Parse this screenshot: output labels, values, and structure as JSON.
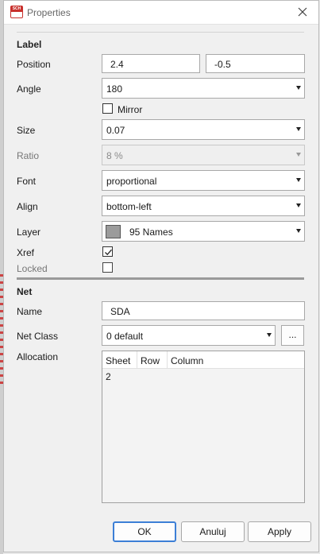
{
  "window": {
    "title": "Properties",
    "app_icon_text": "SCH"
  },
  "label_section": {
    "heading": "Label",
    "position": {
      "label": "Position",
      "x": "2.4",
      "y": "-0.5"
    },
    "angle": {
      "label": "Angle",
      "value": "180"
    },
    "mirror": {
      "label": "Mirror",
      "checked": false
    },
    "size": {
      "label": "Size",
      "value": "0.07"
    },
    "ratio": {
      "label": "Ratio",
      "value": "8 %",
      "disabled": true
    },
    "font": {
      "label": "Font",
      "value": "proportional"
    },
    "align": {
      "label": "Align",
      "value": "bottom-left"
    },
    "layer": {
      "label": "Layer",
      "value": "95 Names",
      "swatch_color": "#9b9b9b"
    },
    "xref": {
      "label": "Xref",
      "checked": true
    },
    "locked": {
      "label": "Locked",
      "checked": false
    }
  },
  "net_section": {
    "heading": "Net",
    "name": {
      "label": "Name",
      "value": "SDA"
    },
    "net_class": {
      "label": "Net Class",
      "value": "0 default",
      "more_button": "..."
    },
    "allocation": {
      "label": "Allocation",
      "columns": [
        "Sheet",
        "Row",
        "Column"
      ],
      "rows": [
        [
          "2",
          "",
          ""
        ]
      ]
    }
  },
  "buttons": {
    "ok": "OK",
    "cancel": "Anuluj",
    "apply": "Apply"
  },
  "colors": {
    "accent": "#3c7fd6",
    "app_icon": "#c8302c"
  }
}
